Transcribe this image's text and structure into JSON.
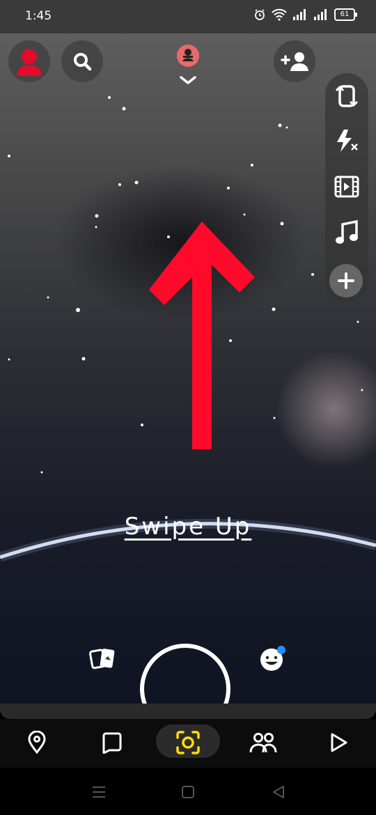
{
  "status_bar": {
    "time": "1:45",
    "battery": "61"
  },
  "overlay": {
    "swipe_label": "Swipe Up"
  },
  "colors": {
    "arrow": "#ff0a2b",
    "nav_active": "#ffe000",
    "notification_dot": "#1e90ff",
    "avatar": "#e10b2a"
  },
  "icons": {
    "top_left": [
      "avatar-icon",
      "search-icon"
    ],
    "top_center": [
      "profile-badge-icon",
      "chevron-down-icon"
    ],
    "top_right": [
      "add-friend-icon"
    ],
    "side_rail": [
      "flip-camera-icon",
      "flash-off-icon",
      "video-icon",
      "music-icon",
      "plus-icon"
    ],
    "capture_row": [
      "memories-icon",
      "lenses-icon"
    ],
    "nav": [
      "map-icon",
      "chat-icon",
      "camera-icon",
      "stories-icon",
      "spotlight-icon"
    ],
    "system": [
      "menu-icon",
      "home-icon",
      "back-icon"
    ]
  }
}
